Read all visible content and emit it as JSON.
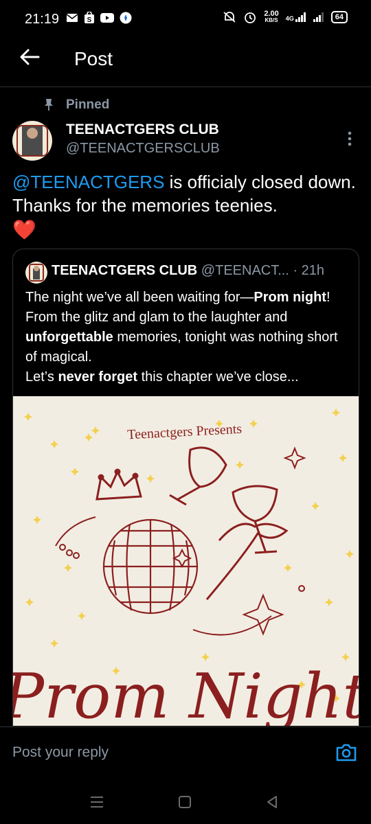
{
  "status_bar": {
    "time": "21:19",
    "speed_value": "2.00",
    "speed_unit": "KB/S",
    "network": "4G",
    "battery": "64"
  },
  "header": {
    "title": "Post"
  },
  "post": {
    "pinned_label": "Pinned",
    "author_name": "TEENACTGERS CLUB",
    "author_handle": "@TEENACTGERSCLUB",
    "mention": "@TEENACTGERS",
    "text": " is officialy closed down. Thanks for the memories teenies.",
    "heart": "❤️"
  },
  "quote": {
    "author_name": "TEENACTGERS CLUB",
    "author_handle": "@TEENACT...",
    "time": "· 21h",
    "body": [
      {
        "t": "The night we’ve all been waiting for—",
        "b": false
      },
      {
        "t": "Prom night",
        "b": true
      },
      {
        "t": "! From the glitz and glam to the laughter and ",
        "b": false
      },
      {
        "t": "unforgettable",
        "b": true
      },
      {
        "t": " memories, tonight was nothing short of magical.",
        "b": false
      },
      {
        "t": "\n",
        "b": false
      },
      {
        "t": "Let’s ",
        "b": false
      },
      {
        "t": "never forget",
        "b": true
      },
      {
        "t": " this chapter we’ve close...",
        "b": false
      }
    ],
    "poster_subtitle": "Teenactgers Presents",
    "poster_title": "Prom Night"
  },
  "reply": {
    "placeholder": "Post your reply"
  },
  "colors": {
    "accent": "#1d9bf0",
    "muted": "#8b98a5",
    "poster_red": "#8b1f1f",
    "star": "#f3d04e"
  }
}
